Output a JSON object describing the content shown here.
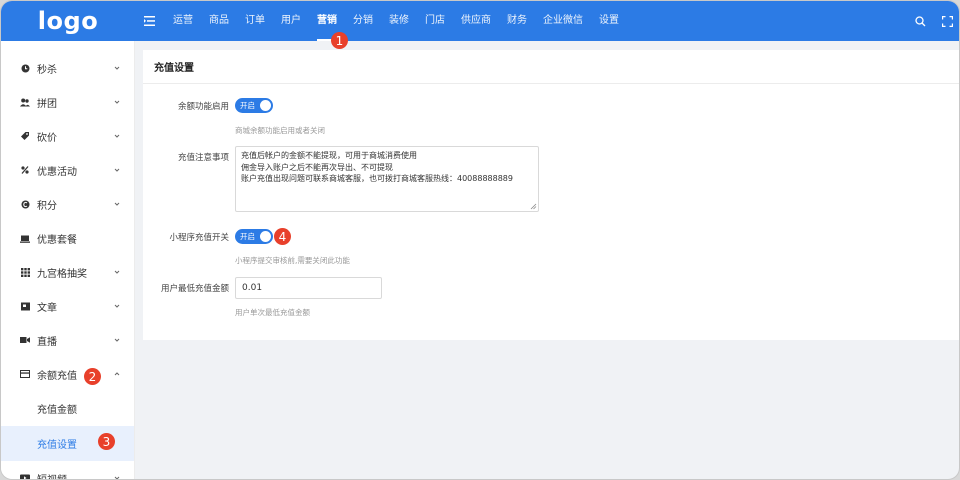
{
  "logo": "logo",
  "nav": [
    "运营",
    "商品",
    "订单",
    "用户",
    "营销",
    "分销",
    "装修",
    "门店",
    "供应商",
    "财务",
    "企业微信",
    "设置"
  ],
  "nav_active_index": 4,
  "top_icons": [
    "search-icon",
    "fullscreen-icon"
  ],
  "sidebar": {
    "items": [
      {
        "label": "秒杀",
        "icon": "clock-icon",
        "has_children": true
      },
      {
        "label": "拼团",
        "icon": "group-icon",
        "has_children": true
      },
      {
        "label": "砍价",
        "icon": "tag-icon",
        "has_children": true
      },
      {
        "label": "优惠活动",
        "icon": "discount-icon",
        "has_children": true
      },
      {
        "label": "积分",
        "icon": "points-icon",
        "has_children": true
      },
      {
        "label": "优惠套餐",
        "icon": "package-icon",
        "has_children": false
      },
      {
        "label": "九宫格抽奖",
        "icon": "grid-icon",
        "has_children": true
      },
      {
        "label": "文章",
        "icon": "article-icon",
        "has_children": true
      },
      {
        "label": "直播",
        "icon": "video-icon",
        "has_children": true
      },
      {
        "label": "余额充值",
        "icon": "wallet-icon",
        "has_children": true,
        "expanded": true
      },
      {
        "label": "短视频",
        "icon": "short-video-icon",
        "has_children": true
      }
    ],
    "sub_items": [
      {
        "label": "充值金额",
        "active": false
      },
      {
        "label": "充值设置",
        "active": true
      }
    ]
  },
  "panel": {
    "title": "充值设置",
    "fields": {
      "balance_enable": {
        "label": "余额功能启用",
        "switch_text": "开启",
        "hint": "商城余额功能启用或者关闭"
      },
      "notice": {
        "label": "充值注意事项",
        "lines": [
          "充值后帐户的金额不能提现，可用于商城消费使用",
          "佣金导入账户之后不能再次导出、不可提现",
          "账户充值出现问题可联系商城客服，也可拨打商城客服热线：40088888889"
        ]
      },
      "mini_program": {
        "label": "小程序充值开关",
        "switch_text": "开启",
        "hint": "小程序提交审核前,需要关闭此功能"
      },
      "min_amount": {
        "label": "用户最低充值金额",
        "value": "0.01",
        "hint": "用户单次最低充值金额"
      }
    }
  },
  "callouts": [
    "1",
    "2",
    "3",
    "4"
  ],
  "colors": {
    "primary": "#2c7be5",
    "callout": "#e8402b",
    "bg": "#f0f2f5"
  }
}
